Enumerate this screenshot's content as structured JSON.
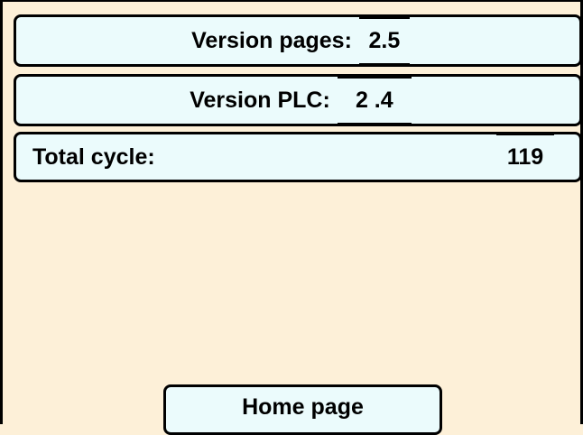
{
  "version_pages": {
    "label": "Version pages:",
    "value": "2.5"
  },
  "version_plc": {
    "label": "Version PLC:",
    "value": "2 .4"
  },
  "total_cycle": {
    "label": "Total cycle:",
    "value": "119"
  },
  "home_button": {
    "label": "Home page"
  },
  "colors": {
    "background": "#fdf0d8",
    "panel": "#ebfbfc",
    "border": "#000000"
  }
}
